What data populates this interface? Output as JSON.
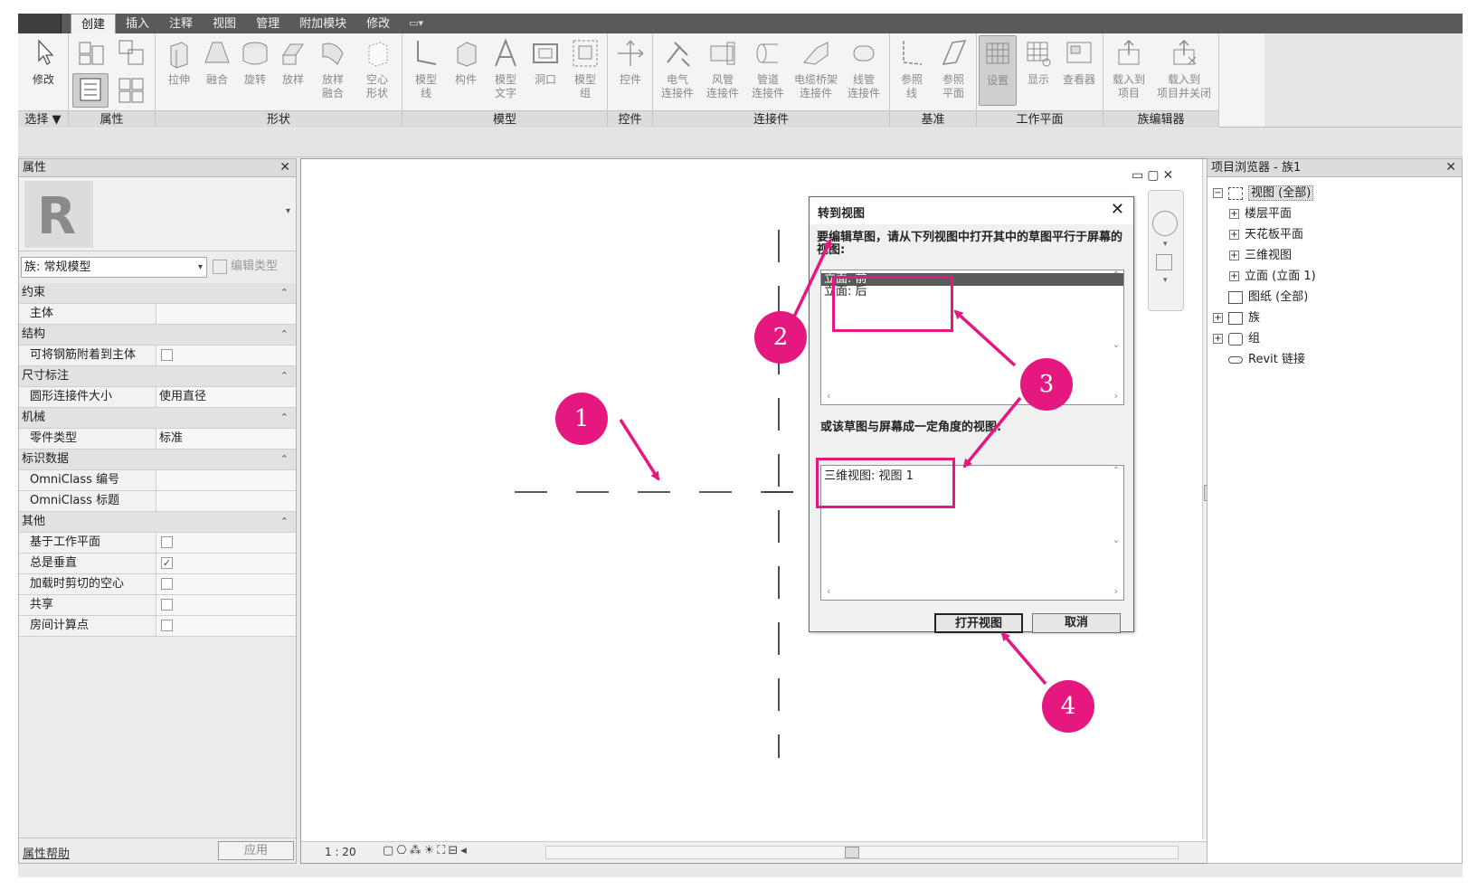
{
  "ribbon": {
    "tabs": [
      "创建",
      "插入",
      "注释",
      "视图",
      "管理",
      "附加模块",
      "修改"
    ],
    "active_tab": "创建",
    "panels": [
      {
        "label": "选择 ▼",
        "tools": [
          "修改"
        ]
      },
      {
        "label": "属性",
        "tools": []
      },
      {
        "label": "形状",
        "tools": [
          "拉伸",
          "融合",
          "旋转",
          "放样",
          "放样\n融合",
          "空心\n形状"
        ]
      },
      {
        "label": "模型",
        "tools": [
          "模型\n线",
          "构件",
          "模型\n文字",
          "洞口",
          "模型\n组"
        ]
      },
      {
        "label": "控件",
        "tools": [
          "控件"
        ]
      },
      {
        "label": "连接件",
        "tools": [
          "电气\n连接件",
          "风管\n连接件",
          "管道\n连接件",
          "电缆桥架\n连接件",
          "线管\n连接件"
        ]
      },
      {
        "label": "基准",
        "tools": [
          "参照\n线",
          "参照\n平面"
        ]
      },
      {
        "label": "工作平面",
        "tools": [
          "设置",
          "显示",
          "查看器"
        ]
      },
      {
        "label": "族编辑器",
        "tools": [
          "载入到\n项目",
          "载入到\n项目并关闭"
        ]
      }
    ]
  },
  "properties": {
    "title": "属性",
    "type_selector": "族: 常规模型",
    "edit_type": "编辑类型",
    "groups": [
      {
        "name": "约束",
        "rows": [
          {
            "k": "主体",
            "v": ""
          }
        ]
      },
      {
        "name": "结构",
        "rows": [
          {
            "k": "可将钢筋附着到主体",
            "v": "",
            "check": false
          }
        ]
      },
      {
        "name": "尺寸标注",
        "rows": [
          {
            "k": "圆形连接件大小",
            "v": "使用直径"
          }
        ]
      },
      {
        "name": "机械",
        "rows": [
          {
            "k": "零件类型",
            "v": "标准"
          }
        ]
      },
      {
        "name": "标识数据",
        "rows": [
          {
            "k": "OmniClass 编号",
            "v": ""
          },
          {
            "k": "OmniClass 标题",
            "v": ""
          }
        ]
      },
      {
        "name": "其他",
        "rows": [
          {
            "k": "基于工作平面",
            "v": "",
            "check": false
          },
          {
            "k": "总是垂直",
            "v": "",
            "check": true
          },
          {
            "k": "加载时剪切的空心",
            "v": "",
            "check": false
          },
          {
            "k": "共享",
            "v": "",
            "check": false
          },
          {
            "k": "房间计算点",
            "v": "",
            "check": false
          }
        ]
      }
    ],
    "help": "属性帮助",
    "apply": "应用"
  },
  "canvas": {
    "scale": "1 : 20"
  },
  "dialog": {
    "title": "转到视图",
    "prompt": "要编辑草图，请从下列视图中打开其中的草图平行于屏幕的视图:",
    "list1": [
      "立面: 前",
      "立面: 后"
    ],
    "list1_selected": 0,
    "prompt2": "或该草图与屏幕成一定角度的视图:",
    "list2": [
      "三维视图: 视图 1"
    ],
    "open_button": "打开视图",
    "cancel_button": "取消"
  },
  "browser": {
    "title": "项目浏览器 - 族1",
    "tree": [
      {
        "label": "视图 (全部)",
        "level": 0,
        "pm": "-",
        "selected": true
      },
      {
        "label": "楼层平面",
        "level": 1,
        "pm": "+"
      },
      {
        "label": "天花板平面",
        "level": 1,
        "pm": "+"
      },
      {
        "label": "三维视图",
        "level": 1,
        "pm": "+"
      },
      {
        "label": "立面 (立面 1)",
        "level": 1,
        "pm": "+"
      },
      {
        "label": "图纸 (全部)",
        "level": 0,
        "pm": ""
      },
      {
        "label": "族",
        "level": 0,
        "pm": "+"
      },
      {
        "label": "组",
        "level": 0,
        "pm": "+"
      },
      {
        "label": "Revit 链接",
        "level": 0,
        "pm": ""
      }
    ]
  },
  "callouts": [
    "1",
    "2",
    "3",
    "4"
  ],
  "colors": {
    "accent": "#e4187f"
  }
}
